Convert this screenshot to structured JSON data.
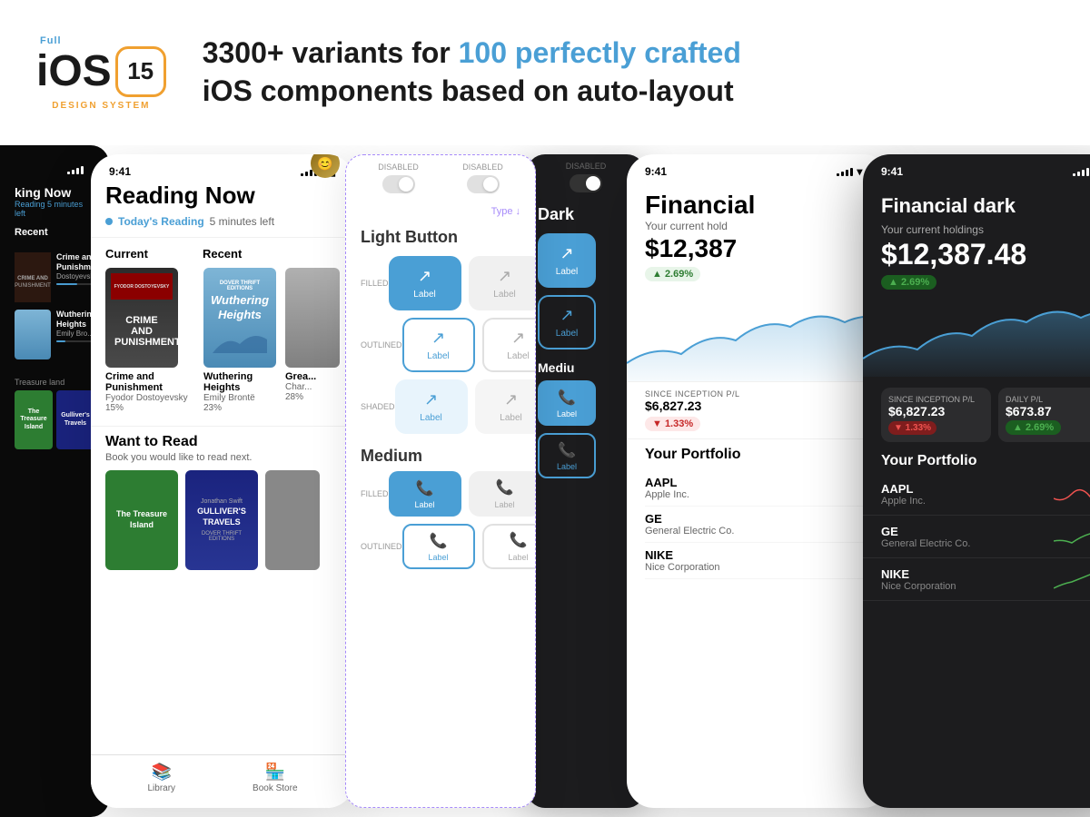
{
  "header": {
    "logo": {
      "full_label": "Full",
      "ios_label": "iOS",
      "version": "15",
      "design_label": "DESIGN SYSTEM"
    },
    "headline": "3300+ variants for ",
    "highlight": "100 perfectly crafted",
    "subline": "iOS components based on auto-layout"
  },
  "dark_phone_left": {
    "title": "king Now",
    "subtitle": "Reading",
    "time_left": "5 minutes left",
    "recent": "Recent",
    "books": [
      {
        "title": "CRIME AND PUNISHMENT",
        "author": "Dostoyevsky",
        "progress": 45
      },
      {
        "title": "Wuthering Heights",
        "author": "Emily Bro",
        "progress": 23
      }
    ],
    "treasure_land": "Treasure land",
    "want_books": [
      {
        "title": "The Treasure Island",
        "color": "green"
      },
      {
        "title": "Gulliver's Travels",
        "color": "dark-blue"
      }
    ]
  },
  "reading_phone": {
    "time": "9:41",
    "title": "Reading Now",
    "today_label": "Today's Reading",
    "time_left": "5 minutes left",
    "current_label": "Current",
    "recent_label": "Recent",
    "books_current": [
      {
        "title": "Crime and Punishment",
        "author": "Fyodor Dostoyevsky",
        "progress": "15%",
        "cover": "crime"
      },
      {
        "title": "Wuthering Heights",
        "author": "Emily Brontë",
        "progress": "23%",
        "cover": "wuthering"
      },
      {
        "title": "Grea...",
        "author": "Char...",
        "progress": "28%",
        "cover": "great"
      }
    ],
    "want_to_read_title": "Want to Read",
    "want_to_read_subtitle": "Book you would like to read next.",
    "want_books": [
      {
        "title": "The Treasure Island",
        "cover": "treasure"
      },
      {
        "title": "Gulliver's Travels",
        "cover": "gulliver"
      },
      {
        "title": "...",
        "cover": "extra"
      }
    ],
    "nav": [
      "Library",
      "Book Store"
    ]
  },
  "components_panel": {
    "type_label": "Type ↓",
    "disabled_labels": [
      "DISABLED",
      "DISABLED",
      "DISABLED"
    ],
    "light_button_title": "Light Button",
    "rows": [
      {
        "type": "FILLED"
      },
      {
        "type": "OUTLINED"
      },
      {
        "type": "SHADED"
      }
    ],
    "medium_title": "Medium",
    "medium_rows": [
      {
        "type": "FILLED"
      },
      {
        "type": "OUTLINED"
      }
    ],
    "button_label": "Label"
  },
  "dark_panel": {
    "title": "Dark",
    "medium_title": "Mediu",
    "button_label": "Label"
  },
  "financial_light": {
    "status_time": "9:41",
    "title": "Financial",
    "holdings_label": "Your current hold",
    "holdings_value": "$12,387",
    "badge_up": "▲ 2.69%",
    "inception_label": "SINCE INCEPTION P/L",
    "inception_value": "$6,827.23",
    "inception_badge": "▼ 1.33%",
    "portfolio_title": "Your Portfolio",
    "stocks": [
      {
        "symbol": "AAPL",
        "company": "Apple Inc."
      },
      {
        "symbol": "GE",
        "company": "General Electric Co."
      },
      {
        "symbol": "NIKE",
        "company": "Nice Corporation"
      }
    ]
  },
  "financial_dark": {
    "status_time": "9:41",
    "title": "Financial dark",
    "holdings_label": "Your current holdings",
    "holdings_value": "$12,387.48",
    "badge_up": "▲ 2.69%",
    "stats": [
      {
        "label": "SINCE INCEPTION P/L",
        "value": "$6,827.23",
        "badge": "▼ 1.33%"
      },
      {
        "label": "DAILY P/L",
        "value": "$673.87",
        "badge": "▲ 2.69%"
      }
    ],
    "portfolio_title": "Your Portfolio",
    "stocks": [
      {
        "symbol": "AAPL",
        "company": "Apple Inc.",
        "trend": "down"
      },
      {
        "symbol": "GE",
        "company": "General Electric Co.",
        "trend": "up"
      },
      {
        "symbol": "NIKE",
        "company": "Nice Corporation",
        "trend": "up"
      }
    ]
  }
}
